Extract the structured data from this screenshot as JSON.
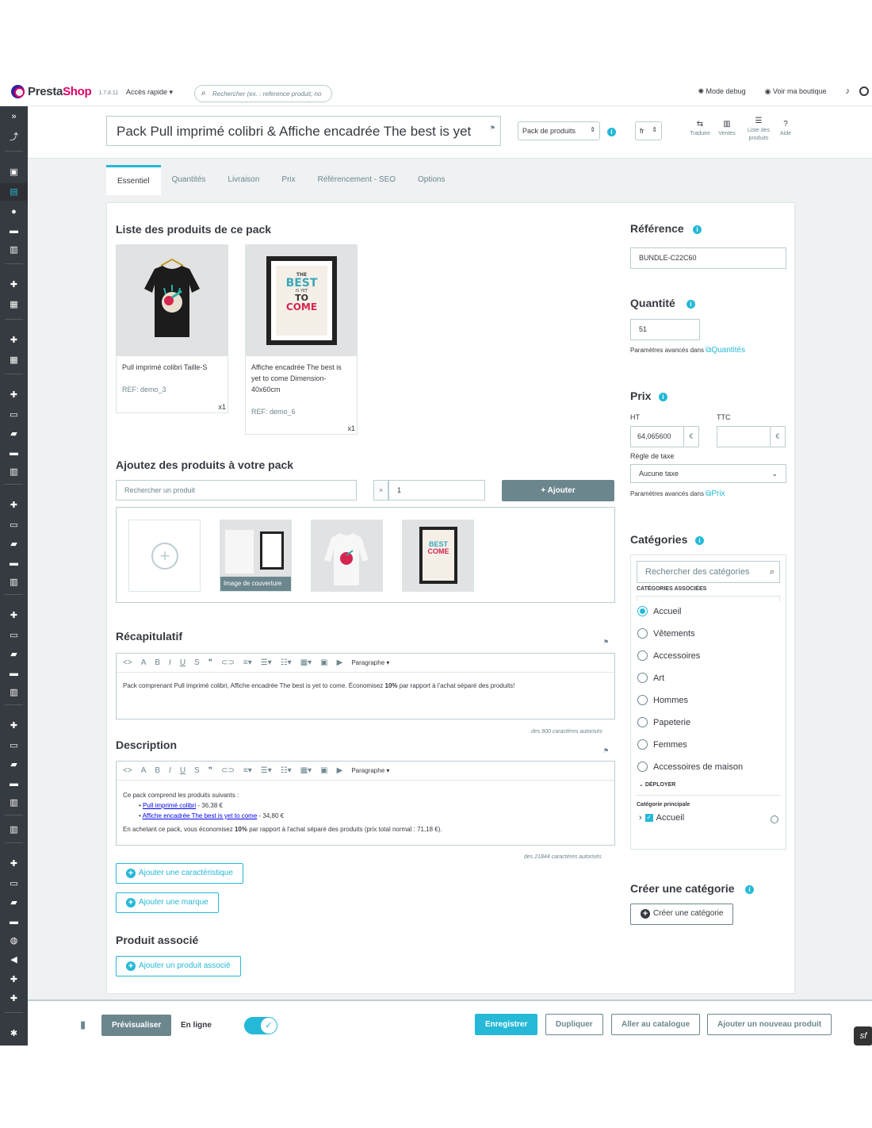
{
  "topbar": {
    "logo_presta": "Presta",
    "logo_shop": "Shop",
    "version": "1.7.8.11",
    "quick_access": "Accès rapide ▾",
    "search_placeholder": "Rechercher (ex. : reference produit, no",
    "debug": "Mode debug",
    "view_shop": "Voir ma boutique"
  },
  "header": {
    "product_name": "Pack Pull imprimé colibri & Affiche encadrée The best is yet",
    "type": "Pack de produits",
    "lang": "fr",
    "actions": [
      {
        "icon": "translate-icon",
        "label": "Traduire"
      },
      {
        "icon": "sales-icon",
        "label": "Ventes"
      },
      {
        "icon": "list-icon",
        "label": "Liste des produits"
      },
      {
        "icon": "help-icon",
        "label": "Aide"
      }
    ]
  },
  "tabs": [
    "Essentiel",
    "Quantités",
    "Livraison",
    "Prix",
    "Référencement - SEO",
    "Options"
  ],
  "pack": {
    "title": "Liste des produits de ce pack",
    "items": [
      {
        "name": "Pull imprimé colibri Taille-S",
        "ref": "REF: demo_3",
        "qty": "x1"
      },
      {
        "name": "Affiche encadrée The best is yet to come Dimension-40x60cm",
        "ref": "REF: demo_6",
        "qty": "x1"
      }
    ],
    "poster": {
      "line1": "THE",
      "line2": "BEST",
      "line3": "IS YET",
      "line4": "TO",
      "line5": "COME"
    }
  },
  "add_pack": {
    "title": "Ajoutez des produits à votre pack",
    "search_placeholder": "Rechercher un produit",
    "times": "×",
    "qty": "1",
    "add_button": "+ Ajouter",
    "cover_label": "Image de couverture"
  },
  "summary": {
    "title": "Récapitulatif",
    "paragraph": "Paragraphe ▾",
    "content_pre": "Pack comprenant Pull imprimé colibri, Affiche encadrée The best is yet to come. Économisez ",
    "content_bold": "10%",
    "content_post": " par rapport à l'achat séparé des produits!",
    "counter": "des 800 caractères autorisés"
  },
  "description": {
    "title": "Description",
    "paragraph": "Paragraphe ▾",
    "intro": "Ce pack comprend les produits suivants :",
    "link1": "Pull imprimé colibri",
    "price1": " - 36,38 €",
    "link2": "Affiche encadrée The best is yet to come",
    "price2": " - 34,80 €",
    "outro_pre": "En achetant ce pack, vous économisez ",
    "outro_bold": "10%",
    "outro_post": " par rapport à l'achat séparé des produits (prix total normal : 71,18 €).",
    "counter": "des 21844 caractères autorisés"
  },
  "buttons": {
    "add_feature": "Ajouter une caractéristique",
    "add_brand": "Ajouter une marque",
    "related_title": "Produit associé",
    "add_related": "Ajouter un produit associé"
  },
  "right": {
    "ref_title": "Référence",
    "ref_value": "BUNDLE-C22C60",
    "qty_title": "Quantité",
    "qty_value": "51",
    "qty_help": "Paramètres avancés dans",
    "qty_link": "Quantités",
    "price_title": "Prix",
    "ht_label": "HT",
    "ttc_label": "TTC",
    "ht_value": "64,065600",
    "currency": "€",
    "tax_label": "Règle de taxe",
    "tax_value": "Aucune taxe",
    "price_help": "Paramètres avancés dans",
    "price_link": "Prix",
    "cat_title": "Catégories",
    "cat_search": "Rechercher des catégories",
    "cat_assoc": "CATÉGORIES ASSOCIÉES",
    "categories": [
      "Accueil",
      "Vêtements",
      "Accessoires",
      "Art",
      "Hommes",
      "Papeterie",
      "Femmes",
      "Accessoires de maison"
    ],
    "deploy": "DÉPLOYER",
    "main_cat_label": "Catégorie principale",
    "main_cat": "Accueil",
    "create_title": "Créer une catégorie",
    "create_button": "Créer une catégorie"
  },
  "footer": {
    "preview": "Prévisualiser",
    "online": "En ligne",
    "save": "Enregistrer",
    "duplicate": "Dupliquer",
    "catalog": "Aller au catalogue",
    "new_product": "Ajouter un nouveau produit"
  },
  "colors": {
    "accent": "#25b9d7",
    "sidebar": "#363a41",
    "brand_pink": "#df0067"
  }
}
